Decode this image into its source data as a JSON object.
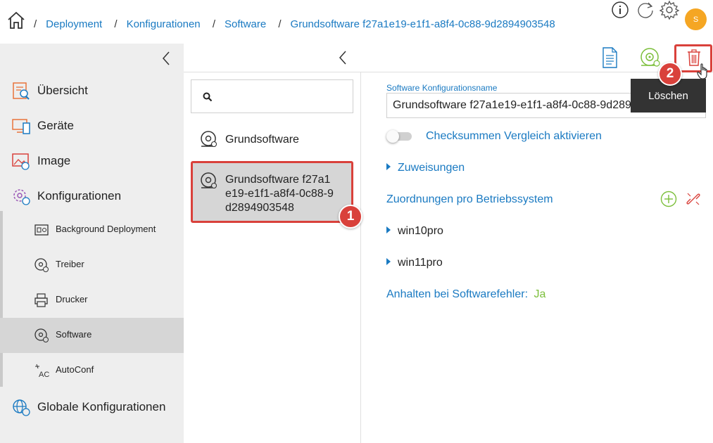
{
  "breadcrumb": {
    "items": [
      "Deployment",
      "Konfigurationen",
      "Software",
      "Grundsoftware f27a1e19-e1f1-a8f4-0c88-9d2894903548"
    ],
    "separator": "/"
  },
  "header": {
    "avatar_initial": "S",
    "icons": [
      "info-icon",
      "refresh-icon",
      "settings-icon"
    ]
  },
  "sidebar": {
    "items": [
      {
        "label": "Übersicht",
        "icon": "overview-icon"
      },
      {
        "label": "Geräte",
        "icon": "devices-icon"
      },
      {
        "label": "Image",
        "icon": "image-icon"
      },
      {
        "label": "Konfigurationen",
        "icon": "configurations-icon"
      }
    ],
    "subitems": [
      {
        "label": "Background Deployment",
        "icon": "background-deployment-icon"
      },
      {
        "label": "Treiber",
        "icon": "driver-icon"
      },
      {
        "label": "Drucker",
        "icon": "printer-icon"
      },
      {
        "label": "Software",
        "icon": "software-icon",
        "active": true
      },
      {
        "label": "AutoConf",
        "icon": "autoconf-icon"
      }
    ],
    "bottom_item": {
      "label": "Globale Konfigurationen",
      "icon": "global-config-icon"
    }
  },
  "list": {
    "search_placeholder": "",
    "items": [
      {
        "label": "Grundsoftware"
      },
      {
        "label_lines": [
          "Grundsoftware f27a1",
          "e19-e1f1-a8f4-0c88-9",
          "d2894903548"
        ],
        "selected": true
      }
    ]
  },
  "detail": {
    "name_label": "Software Konfigurationsname",
    "name_value": "Grundsoftware f27a1e19-e1f1-a8f4-0c88-9d2894903548",
    "checksum_toggle_label": "Checksummen Vergleich aktivieren",
    "checksum_enabled": false,
    "assignments_label": "Zuweisungen",
    "os_mappings_label": "Zuordnungen pro Betriebssystem",
    "os_items": [
      "win10pro",
      "win11pro"
    ],
    "halt_label": "Anhalten bei Softwarefehler:",
    "halt_value": "Ja"
  },
  "toolbar": {
    "icons": [
      "document-icon",
      "install-software-icon",
      "delete-icon"
    ],
    "delete_tooltip": "Löschen"
  },
  "annotations": {
    "step1": "1",
    "step2": "2"
  },
  "colors": {
    "accent": "#1a7ac2",
    "green": "#7cbf3b",
    "highlight_red": "#d9413b",
    "sidebar_bg": "#eeeeee",
    "selected_bg": "#d6d6d6"
  }
}
